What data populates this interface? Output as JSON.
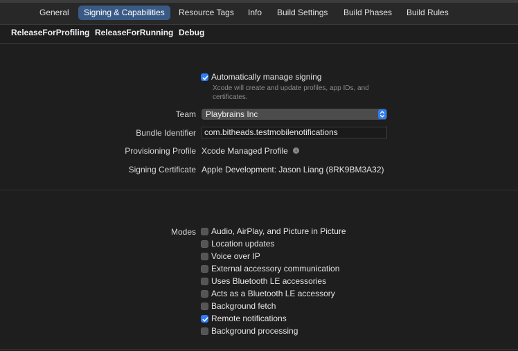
{
  "tabs": [
    {
      "label": "General",
      "active": false
    },
    {
      "label": "Signing & Capabilities",
      "active": true
    },
    {
      "label": "Resource Tags",
      "active": false
    },
    {
      "label": "Info",
      "active": false
    },
    {
      "label": "Build Settings",
      "active": false
    },
    {
      "label": "Build Phases",
      "active": false
    },
    {
      "label": "Build Rules",
      "active": false
    }
  ],
  "configurations": [
    "ReleaseForProfiling",
    "ReleaseForRunning",
    "Debug"
  ],
  "signing": {
    "auto_manage_label": "Automatically manage signing",
    "auto_manage_checked": true,
    "auto_manage_subtext": "Xcode will create and update profiles, app IDs, and certificates.",
    "team_label": "Team",
    "team_value": "Playbrains Inc",
    "bundle_label": "Bundle Identifier",
    "bundle_value": "com.bitheads.testmobilenotifications",
    "profile_label": "Provisioning Profile",
    "profile_value": "Xcode Managed Profile",
    "certificate_label": "Signing Certificate",
    "certificate_value": "Apple Development: Jason Liang (8RK9BM3A32)"
  },
  "modes": {
    "label": "Modes",
    "items": [
      {
        "label": "Audio, AirPlay, and Picture in Picture",
        "checked": false
      },
      {
        "label": "Location updates",
        "checked": false
      },
      {
        "label": "Voice over IP",
        "checked": false
      },
      {
        "label": "External accessory communication",
        "checked": false
      },
      {
        "label": "Uses Bluetooth LE accessories",
        "checked": false
      },
      {
        "label": "Acts as a Bluetooth LE accessory",
        "checked": false
      },
      {
        "label": "Background fetch",
        "checked": false
      },
      {
        "label": "Remote notifications",
        "checked": true
      },
      {
        "label": "Background processing",
        "checked": false
      }
    ]
  },
  "colors": {
    "accent": "#2e7cf6",
    "active_tab": "#3a5a86",
    "background": "#1e1e1e"
  }
}
